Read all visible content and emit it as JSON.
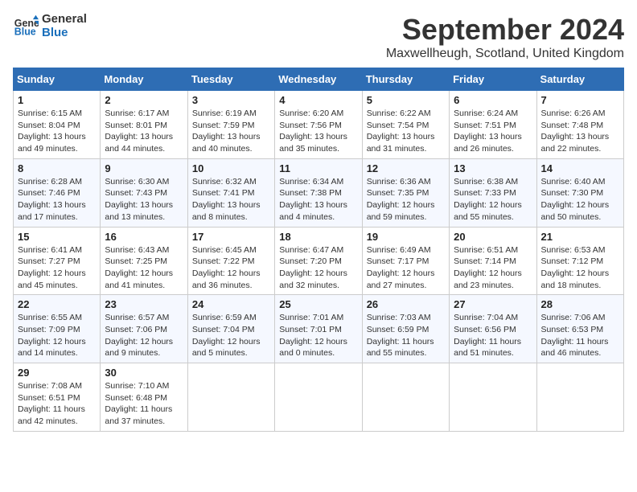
{
  "header": {
    "logo_line1": "General",
    "logo_line2": "Blue",
    "month_title": "September 2024",
    "location": "Maxwellheugh, Scotland, United Kingdom"
  },
  "weekdays": [
    "Sunday",
    "Monday",
    "Tuesday",
    "Wednesday",
    "Thursday",
    "Friday",
    "Saturday"
  ],
  "weeks": [
    [
      {
        "day": "1",
        "info": "Sunrise: 6:15 AM\nSunset: 8:04 PM\nDaylight: 13 hours\nand 49 minutes."
      },
      {
        "day": "2",
        "info": "Sunrise: 6:17 AM\nSunset: 8:01 PM\nDaylight: 13 hours\nand 44 minutes."
      },
      {
        "day": "3",
        "info": "Sunrise: 6:19 AM\nSunset: 7:59 PM\nDaylight: 13 hours\nand 40 minutes."
      },
      {
        "day": "4",
        "info": "Sunrise: 6:20 AM\nSunset: 7:56 PM\nDaylight: 13 hours\nand 35 minutes."
      },
      {
        "day": "5",
        "info": "Sunrise: 6:22 AM\nSunset: 7:54 PM\nDaylight: 13 hours\nand 31 minutes."
      },
      {
        "day": "6",
        "info": "Sunrise: 6:24 AM\nSunset: 7:51 PM\nDaylight: 13 hours\nand 26 minutes."
      },
      {
        "day": "7",
        "info": "Sunrise: 6:26 AM\nSunset: 7:48 PM\nDaylight: 13 hours\nand 22 minutes."
      }
    ],
    [
      {
        "day": "8",
        "info": "Sunrise: 6:28 AM\nSunset: 7:46 PM\nDaylight: 13 hours\nand 17 minutes."
      },
      {
        "day": "9",
        "info": "Sunrise: 6:30 AM\nSunset: 7:43 PM\nDaylight: 13 hours\nand 13 minutes."
      },
      {
        "day": "10",
        "info": "Sunrise: 6:32 AM\nSunset: 7:41 PM\nDaylight: 13 hours\nand 8 minutes."
      },
      {
        "day": "11",
        "info": "Sunrise: 6:34 AM\nSunset: 7:38 PM\nDaylight: 13 hours\nand 4 minutes."
      },
      {
        "day": "12",
        "info": "Sunrise: 6:36 AM\nSunset: 7:35 PM\nDaylight: 12 hours\nand 59 minutes."
      },
      {
        "day": "13",
        "info": "Sunrise: 6:38 AM\nSunset: 7:33 PM\nDaylight: 12 hours\nand 55 minutes."
      },
      {
        "day": "14",
        "info": "Sunrise: 6:40 AM\nSunset: 7:30 PM\nDaylight: 12 hours\nand 50 minutes."
      }
    ],
    [
      {
        "day": "15",
        "info": "Sunrise: 6:41 AM\nSunset: 7:27 PM\nDaylight: 12 hours\nand 45 minutes."
      },
      {
        "day": "16",
        "info": "Sunrise: 6:43 AM\nSunset: 7:25 PM\nDaylight: 12 hours\nand 41 minutes."
      },
      {
        "day": "17",
        "info": "Sunrise: 6:45 AM\nSunset: 7:22 PM\nDaylight: 12 hours\nand 36 minutes."
      },
      {
        "day": "18",
        "info": "Sunrise: 6:47 AM\nSunset: 7:20 PM\nDaylight: 12 hours\nand 32 minutes."
      },
      {
        "day": "19",
        "info": "Sunrise: 6:49 AM\nSunset: 7:17 PM\nDaylight: 12 hours\nand 27 minutes."
      },
      {
        "day": "20",
        "info": "Sunrise: 6:51 AM\nSunset: 7:14 PM\nDaylight: 12 hours\nand 23 minutes."
      },
      {
        "day": "21",
        "info": "Sunrise: 6:53 AM\nSunset: 7:12 PM\nDaylight: 12 hours\nand 18 minutes."
      }
    ],
    [
      {
        "day": "22",
        "info": "Sunrise: 6:55 AM\nSunset: 7:09 PM\nDaylight: 12 hours\nand 14 minutes."
      },
      {
        "day": "23",
        "info": "Sunrise: 6:57 AM\nSunset: 7:06 PM\nDaylight: 12 hours\nand 9 minutes."
      },
      {
        "day": "24",
        "info": "Sunrise: 6:59 AM\nSunset: 7:04 PM\nDaylight: 12 hours\nand 5 minutes."
      },
      {
        "day": "25",
        "info": "Sunrise: 7:01 AM\nSunset: 7:01 PM\nDaylight: 12 hours\nand 0 minutes."
      },
      {
        "day": "26",
        "info": "Sunrise: 7:03 AM\nSunset: 6:59 PM\nDaylight: 11 hours\nand 55 minutes."
      },
      {
        "day": "27",
        "info": "Sunrise: 7:04 AM\nSunset: 6:56 PM\nDaylight: 11 hours\nand 51 minutes."
      },
      {
        "day": "28",
        "info": "Sunrise: 7:06 AM\nSunset: 6:53 PM\nDaylight: 11 hours\nand 46 minutes."
      }
    ],
    [
      {
        "day": "29",
        "info": "Sunrise: 7:08 AM\nSunset: 6:51 PM\nDaylight: 11 hours\nand 42 minutes."
      },
      {
        "day": "30",
        "info": "Sunrise: 7:10 AM\nSunset: 6:48 PM\nDaylight: 11 hours\nand 37 minutes."
      },
      null,
      null,
      null,
      null,
      null
    ]
  ]
}
